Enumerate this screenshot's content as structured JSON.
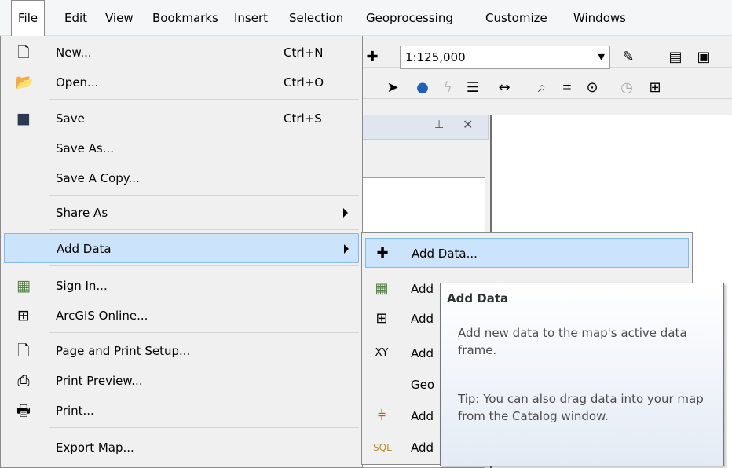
{
  "menubar": {
    "items": [
      "File",
      "Edit",
      "View",
      "Bookmarks",
      "Insert",
      "Selection",
      "Geoprocessing",
      "Customize",
      "Windows"
    ]
  },
  "toolbar": {
    "scale_value": "1:125,000"
  },
  "file_menu": {
    "items": [
      {
        "label": "New...",
        "shortcut": "Ctrl+N",
        "icon": "new-document-icon"
      },
      {
        "label": "Open...",
        "shortcut": "Ctrl+O",
        "icon": "open-folder-icon"
      },
      {
        "label": "Save",
        "shortcut": "Ctrl+S",
        "icon": "save-disk-icon"
      },
      {
        "label": "Save As...",
        "shortcut": ""
      },
      {
        "label": "Save A Copy...",
        "shortcut": ""
      },
      {
        "label": "Share As",
        "shortcut": "",
        "submenu": true
      },
      {
        "label": "Add Data",
        "shortcut": "",
        "submenu": true,
        "highlighted": true
      },
      {
        "label": "Sign In...",
        "icon": "sign-in-icon"
      },
      {
        "label": "ArcGIS Online...",
        "icon": "arcgis-online-icon"
      },
      {
        "label": "Page and Print Setup...",
        "icon": "page-setup-icon"
      },
      {
        "label": "Print Preview...",
        "icon": "print-preview-icon"
      },
      {
        "label": "Print...",
        "icon": "printer-icon"
      },
      {
        "label": "Export Map..."
      }
    ]
  },
  "add_data_submenu": {
    "items": [
      {
        "label": "Add Data...",
        "icon": "add-data-icon",
        "highlighted": true
      },
      {
        "label": "Add",
        "icon": "basemap-icon"
      },
      {
        "label": "Add",
        "icon": "grid-icon"
      },
      {
        "label": "Add",
        "icon": "xy-data-icon"
      },
      {
        "label": "Geo"
      },
      {
        "label": "Add",
        "icon": "route-events-icon"
      },
      {
        "label": "Add",
        "icon": "sql-query-icon"
      }
    ]
  },
  "tooltip": {
    "title": "Add Data",
    "description": "Add new data to the map's active data frame.",
    "tip": "Tip: You can also drag data into your map from the Catalog window."
  }
}
